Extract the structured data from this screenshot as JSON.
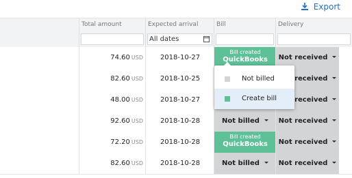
{
  "toolbar": {
    "export_label": "Export"
  },
  "columns": {
    "total_amount": "Total amount",
    "expected_arrival": "Expected arrival",
    "bill": "Bill",
    "delivery": "Delivery"
  },
  "filters": {
    "expected_arrival_value": "All dates"
  },
  "currency": "USD",
  "rows": [
    {
      "amount": "74.60",
      "date": "2018-10-27",
      "bill_status": "created",
      "bill_line1": "Bill created",
      "bill_line2": "QuickBooks",
      "delivery": "Not received"
    },
    {
      "amount": "82.60",
      "date": "2018-10-25",
      "bill_status": "none",
      "bill_label": "",
      "delivery": "Not received"
    },
    {
      "amount": "48.00",
      "date": "2018-10-27",
      "bill_status": "none",
      "bill_label": "",
      "delivery": "Not received"
    },
    {
      "amount": "92.60",
      "date": "2018-10-28",
      "bill_status": "not_billed",
      "bill_label": "Not billed",
      "delivery": "Not received"
    },
    {
      "amount": "72.20",
      "date": "2018-10-28",
      "bill_status": "created",
      "bill_line1": "Bill created",
      "bill_line2": "QuickBooks",
      "delivery": "Not received"
    },
    {
      "amount": "82.60",
      "date": "2018-10-28",
      "bill_status": "not_billed",
      "bill_label": "Not billed",
      "delivery": "Not received"
    }
  ],
  "bill_menu": {
    "options": [
      {
        "label": "Not billed",
        "color": "#d2d4d6"
      },
      {
        "label": "Create bill",
        "color": "#5ec097",
        "highlighted": true
      }
    ]
  },
  "colors": {
    "accent": "#1f6fc5",
    "bill_created": "#5ec097",
    "neutral_box": "#d2d4d6",
    "highlight": "#e3eef8"
  }
}
